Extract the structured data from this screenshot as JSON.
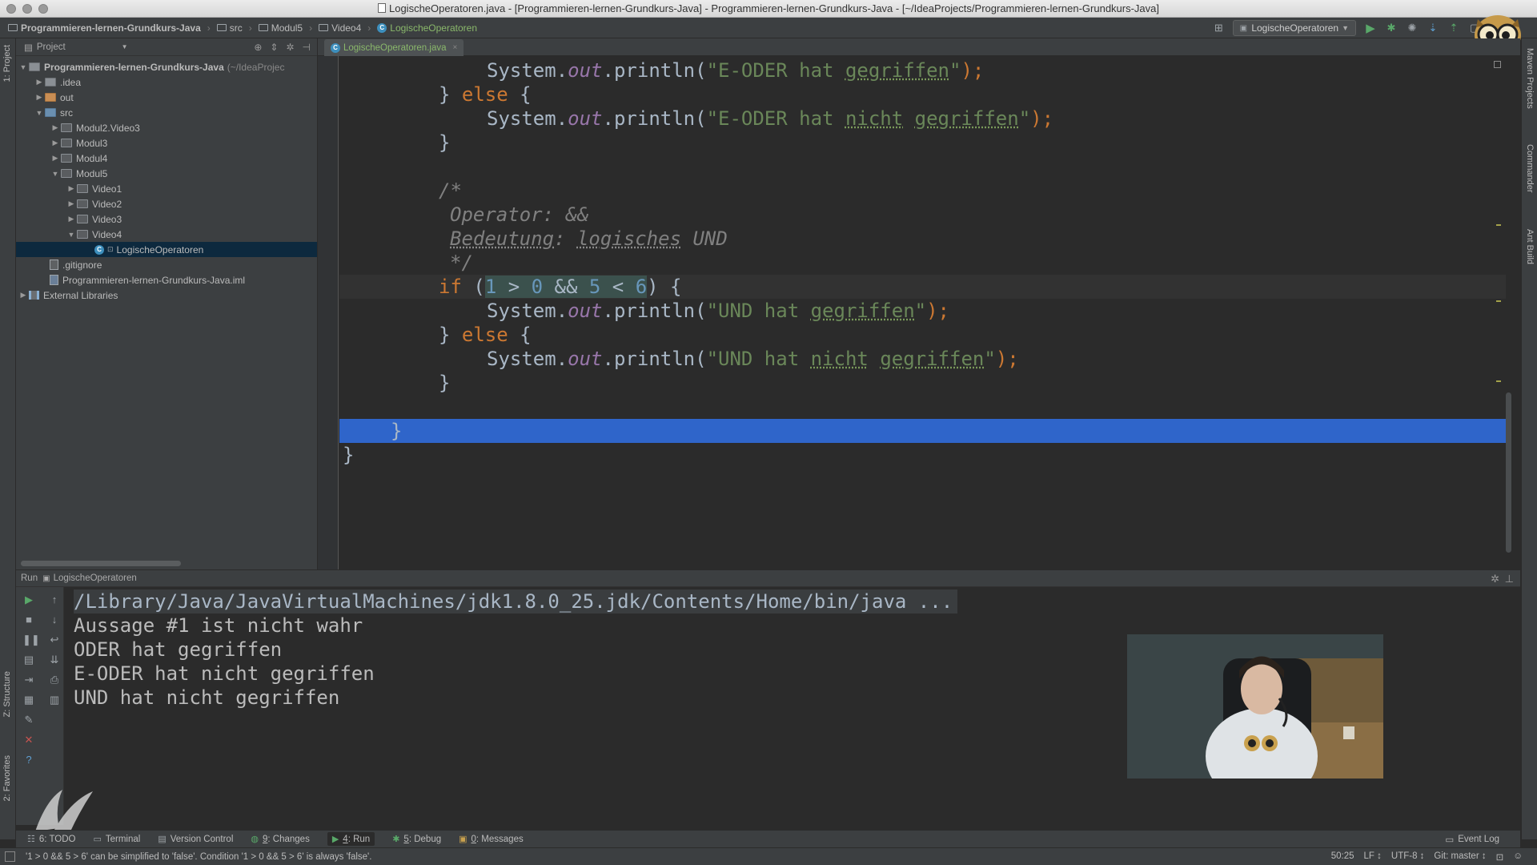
{
  "window": {
    "title": "LogischeOperatoren.java - [Programmieren-lernen-Grundkurs-Java] - Programmieren-lernen-Grundkurs-Java - [~/IdeaProjects/Programmieren-lernen-Grundkurs-Java]"
  },
  "breadcrumbs": [
    {
      "label": "Programmieren-lernen-Grundkurs-Java"
    },
    {
      "label": "src"
    },
    {
      "label": "Modul5"
    },
    {
      "label": "Video4"
    },
    {
      "label": "LogischeOperatoren"
    }
  ],
  "toolbar": {
    "run_config": "LogischeOperatoren"
  },
  "left_strip": {
    "project_tab": "1: Project",
    "structure_tab": "Z: Structure",
    "favorites_tab": "2: Favorites"
  },
  "right_strip": {
    "maven_tab": "Maven Projects",
    "commander_tab": "Commander",
    "ant_tab": "Ant Build"
  },
  "project_panel": {
    "header": "Project",
    "root": {
      "label": "Programmieren-lernen-Grundkurs-Java",
      "path": "(~/IdeaProjec"
    },
    "items": [
      {
        "label": ".idea"
      },
      {
        "label": "out"
      },
      {
        "label": "src"
      },
      {
        "label": "Modul2.Video3"
      },
      {
        "label": "Modul3"
      },
      {
        "label": "Modul4"
      },
      {
        "label": "Modul5"
      },
      {
        "label": "Video1"
      },
      {
        "label": "Video2"
      },
      {
        "label": "Video3"
      },
      {
        "label": "Video4"
      },
      {
        "label": "LogischeOperatoren"
      },
      {
        "label": ".gitignore"
      },
      {
        "label": "Programmieren-lernen-Grundkurs-Java.iml"
      },
      {
        "label": "External Libraries"
      }
    ]
  },
  "editor": {
    "tab_label": "LogischeOperatoren.java",
    "tokens": {
      "system": "System.",
      "out": "out",
      "println": ".println(",
      "end": ");",
      "close_brace": "}",
      "else_open": "} ",
      "else": "else",
      "brace_open": " {",
      "if": "if",
      "s_eoder_1": "\"E-ODER hat ",
      "s_gegriffen": "gegriffen",
      "s_close": "\"",
      "s_eoder_2": "\"E-ODER hat ",
      "s_nicht": "nicht",
      "s_space": " ",
      "c_open": "/*",
      "c_op": "Operator: &&",
      "c_bed_label": "Bedeutung",
      "c_bed_colon": ": ",
      "c_logisches": "logisches",
      "c_und": " UND",
      "c_close": "*/",
      "if_paren": " (",
      "n1": "1",
      "gt": " > ",
      "n0": "0",
      "and": " && ",
      "n5": "5",
      "lt": " < ",
      "n6": "6",
      "if_close": ") {",
      "s_und_1": "\"UND hat ",
      "s_und_2": "\"UND hat "
    }
  },
  "run_panel": {
    "title": "Run",
    "config": "LogischeOperatoren",
    "console": [
      "/Library/Java/JavaVirtualMachines/jdk1.8.0_25.jdk/Contents/Home/bin/java ...",
      "Aussage #1 ist nicht wahr",
      "ODER hat gegriffen",
      "E-ODER hat nicht gegriffen",
      "UND hat nicht gegriffen"
    ]
  },
  "tool_tabs": {
    "todo": "6: TODO",
    "terminal": "Terminal",
    "vcs": "Version Control",
    "changes_num": "9",
    "changes": ": Changes",
    "run_num": "4",
    "run": ": Run",
    "debug_num": "5",
    "debug": ": Debug",
    "messages_num": "0",
    "messages": ": Messages",
    "event_log": "Event Log"
  },
  "status": {
    "message": "'1 > 0 && 5 > 6' can be simplified to 'false'. Condition '1 > 0 && 5 > 6' is always 'false'.",
    "position": "50:25",
    "line_sep": "LF ↕",
    "encoding": "UTF-8 ↕",
    "vcs": "Git: master ↕"
  },
  "colors": {
    "keyword": "#cc7832",
    "string": "#6a8759",
    "number": "#6897bb",
    "comment": "#808080",
    "field": "#9876aa",
    "selection": "#2f65ca"
  }
}
